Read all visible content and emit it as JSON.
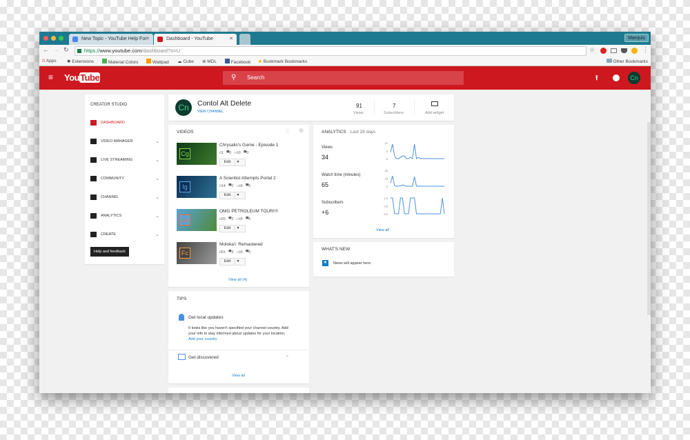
{
  "browser": {
    "tabs": [
      {
        "title": "New Topic - YouTube Help For",
        "active": false
      },
      {
        "title": "Dashboard - YouTube",
        "active": true
      }
    ],
    "user": "Marquis",
    "url_scheme": "https://",
    "url_host": "www.youtube.com",
    "url_path": "/dashboard?o=U",
    "bookmarks": [
      "Apps",
      "Extensions",
      "Material Colors",
      "Wattpad",
      "Cube",
      "MDL",
      "Facebook",
      "Bookmark Bookmarks"
    ],
    "other_bookmarks": "Other Bookmarks"
  },
  "header": {
    "logo": "YouTube",
    "search_placeholder": "Search",
    "avatar": "Cn",
    "brand_color": "#cc181e"
  },
  "sidebar": {
    "title": "CREATOR STUDIO",
    "items": [
      {
        "label": "DASHBOARD",
        "active": true,
        "icon": "dashboard-icon"
      },
      {
        "label": "VIDEO MANAGER",
        "icon": "video-manager-icon"
      },
      {
        "label": "LIVE STREAMING",
        "icon": "live-icon"
      },
      {
        "label": "COMMUNITY",
        "icon": "community-icon"
      },
      {
        "label": "CHANNEL",
        "icon": "channel-icon"
      },
      {
        "label": "ANALYTICS",
        "icon": "analytics-icon"
      },
      {
        "label": "CREATE",
        "icon": "create-icon"
      }
    ],
    "help": "Help and feedback"
  },
  "channel": {
    "avatar": "Cn",
    "name": "Contol Alt Delete",
    "view_channel": "VIEW CHANNEL",
    "views": "91",
    "views_label": "Views",
    "subs": "7",
    "subs_label": "Subscribers",
    "add_widget": "Add widget"
  },
  "videos": {
    "title": "VIDEOS",
    "items": [
      {
        "title": "Chrysalis's Game - Episode 1",
        "logo": "Cg",
        "views": "1",
        "comments": "0",
        "likes": "0",
        "dislikes": "0"
      },
      {
        "title": "A Scientist Attempts Portal 2",
        "logo": "Ig",
        "views": "14",
        "comments": "0",
        "likes": "0",
        "dislikes": "0"
      },
      {
        "title": "OMG PETROLEUM TOUR!!!!",
        "logo": "Le",
        "views": "20",
        "comments": "2",
        "likes": "0",
        "dislikes": "0"
      },
      {
        "title": "Moloka'i: Remastered",
        "logo": "Fc",
        "views": "61",
        "comments": "3",
        "likes": "0",
        "dislikes": "0"
      }
    ],
    "edit": "Edit",
    "view_all": "View all (4)"
  },
  "analytics": {
    "title": "ANALYTICS",
    "period": "Last 28 days",
    "view_all": "View all",
    "metrics": [
      {
        "label": "Views",
        "value": "34",
        "ticks": [
          "12",
          "6",
          "0"
        ],
        "max": 12,
        "data": [
          5,
          11,
          2,
          0,
          0,
          1,
          2,
          2,
          0,
          0,
          1,
          0,
          11,
          0,
          1,
          0,
          0,
          0,
          0,
          0,
          0,
          0,
          0,
          0,
          0,
          0,
          0,
          0
        ]
      },
      {
        "label": "Watch time (minutes)",
        "value": "65",
        "ticks": [
          "40",
          "20",
          "0"
        ],
        "max": 40,
        "data": [
          8,
          26,
          2,
          0,
          0,
          1,
          3,
          2,
          0,
          0,
          0,
          0,
          24,
          0,
          0,
          0,
          0,
          0,
          0,
          0,
          0,
          0,
          0,
          0,
          0,
          0,
          0,
          0
        ]
      },
      {
        "label": "Subscribers",
        "value": "+6",
        "ticks": [
          "1.0",
          "0.5",
          "0.0"
        ],
        "max": 1,
        "data": [
          1,
          1,
          0,
          0,
          0,
          1,
          1,
          0,
          0,
          0,
          1,
          1,
          1,
          0,
          0,
          0,
          0,
          0,
          0,
          0,
          0,
          0,
          0,
          0,
          0,
          0,
          1,
          0
        ]
      }
    ]
  },
  "whats_new": {
    "title": "WHAT'S NEW",
    "text": "News will appear here."
  },
  "tips": {
    "title": "TIPS",
    "local_title": "Get local updates",
    "local_text": "It looks like you haven't specified your channel country. Add your info to stay informed about updates for your location.",
    "local_link": "Add your country",
    "discover_title": "Get discovered",
    "view_all": "View all"
  }
}
